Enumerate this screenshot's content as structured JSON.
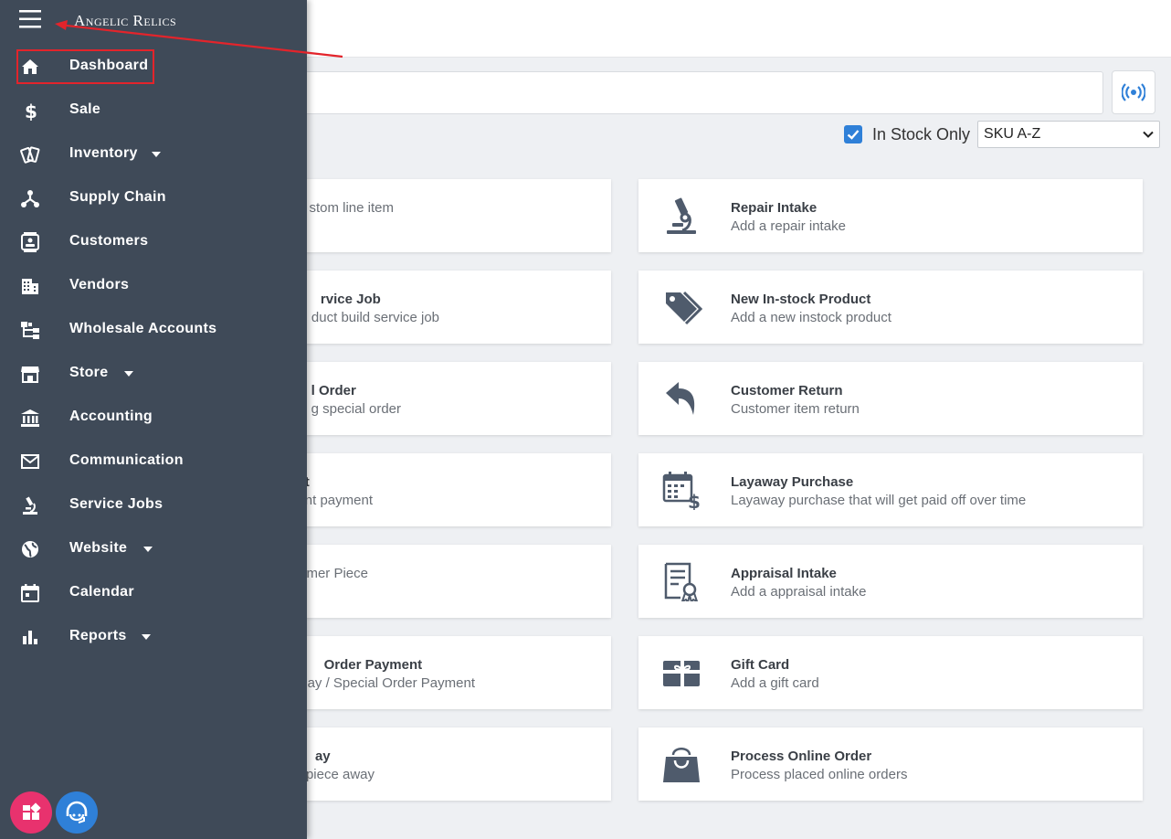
{
  "brand": "Angelic Relics",
  "nav": [
    {
      "label": "Dashboard",
      "icon": "home-icon",
      "caret": false
    },
    {
      "label": "Sale",
      "icon": "dollar-icon",
      "caret": false
    },
    {
      "label": "Inventory",
      "icon": "rings-icon",
      "caret": true
    },
    {
      "label": "Supply Chain",
      "icon": "network-icon",
      "caret": false
    },
    {
      "label": "Customers",
      "icon": "contact-card-icon",
      "caret": false
    },
    {
      "label": "Vendors",
      "icon": "building-icon",
      "caret": false
    },
    {
      "label": "Wholesale Accounts",
      "icon": "hierarchy-icon",
      "caret": false
    },
    {
      "label": "Store",
      "icon": "storefront-icon",
      "caret": true
    },
    {
      "label": "Accounting",
      "icon": "bank-icon",
      "caret": false
    },
    {
      "label": "Communication",
      "icon": "envelope-icon",
      "caret": false
    },
    {
      "label": "Service Jobs",
      "icon": "microscope-icon",
      "caret": false
    },
    {
      "label": "Website",
      "icon": "globe-icon",
      "caret": true
    },
    {
      "label": "Calendar",
      "icon": "calendar-icon",
      "caret": false
    },
    {
      "label": "Reports",
      "icon": "bar-chart-icon",
      "caret": true
    }
  ],
  "filters": {
    "in_stock_label": "In Stock Only",
    "in_stock_checked": true,
    "sort_selected": "SKU A-Z"
  },
  "cards_left": [
    {
      "title": "",
      "sub": "stom line item"
    },
    {
      "title": "rvice Job",
      "sub": "duct build service job"
    },
    {
      "title": "l Order",
      "sub": "g special order"
    },
    {
      "title": "t",
      "sub": "nt payment"
    },
    {
      "title": "",
      "sub": "mer Piece"
    },
    {
      "title": "Order Payment",
      "sub": "ay / Special Order Payment"
    },
    {
      "title": "ay",
      "sub": "piece away"
    }
  ],
  "cards_right": [
    {
      "title": "Repair Intake",
      "sub": "Add a repair intake",
      "icon": "microscope-icon"
    },
    {
      "title": "New In-stock Product",
      "sub": "Add a new instock product",
      "icon": "tags-icon"
    },
    {
      "title": "Customer Return",
      "sub": "Customer item return",
      "icon": "return-arrow-icon"
    },
    {
      "title": "Layaway Purchase",
      "sub": "Layaway purchase that will get paid off over time",
      "icon": "calendar-dollar-icon"
    },
    {
      "title": "Appraisal Intake",
      "sub": "Add a appraisal intake",
      "icon": "certificate-icon"
    },
    {
      "title": "Gift Card",
      "sub": "Add a gift card",
      "icon": "gift-card-icon"
    },
    {
      "title": "Process Online Order",
      "sub": "Process placed online orders",
      "icon": "shopping-bag-icon"
    }
  ],
  "colors": {
    "sidebar": "#3f4a58",
    "accent": "#2f80d8",
    "highlight": "#e3242b",
    "widget_pink": "#e8326e",
    "icon_gray": "#4f5b6c"
  }
}
